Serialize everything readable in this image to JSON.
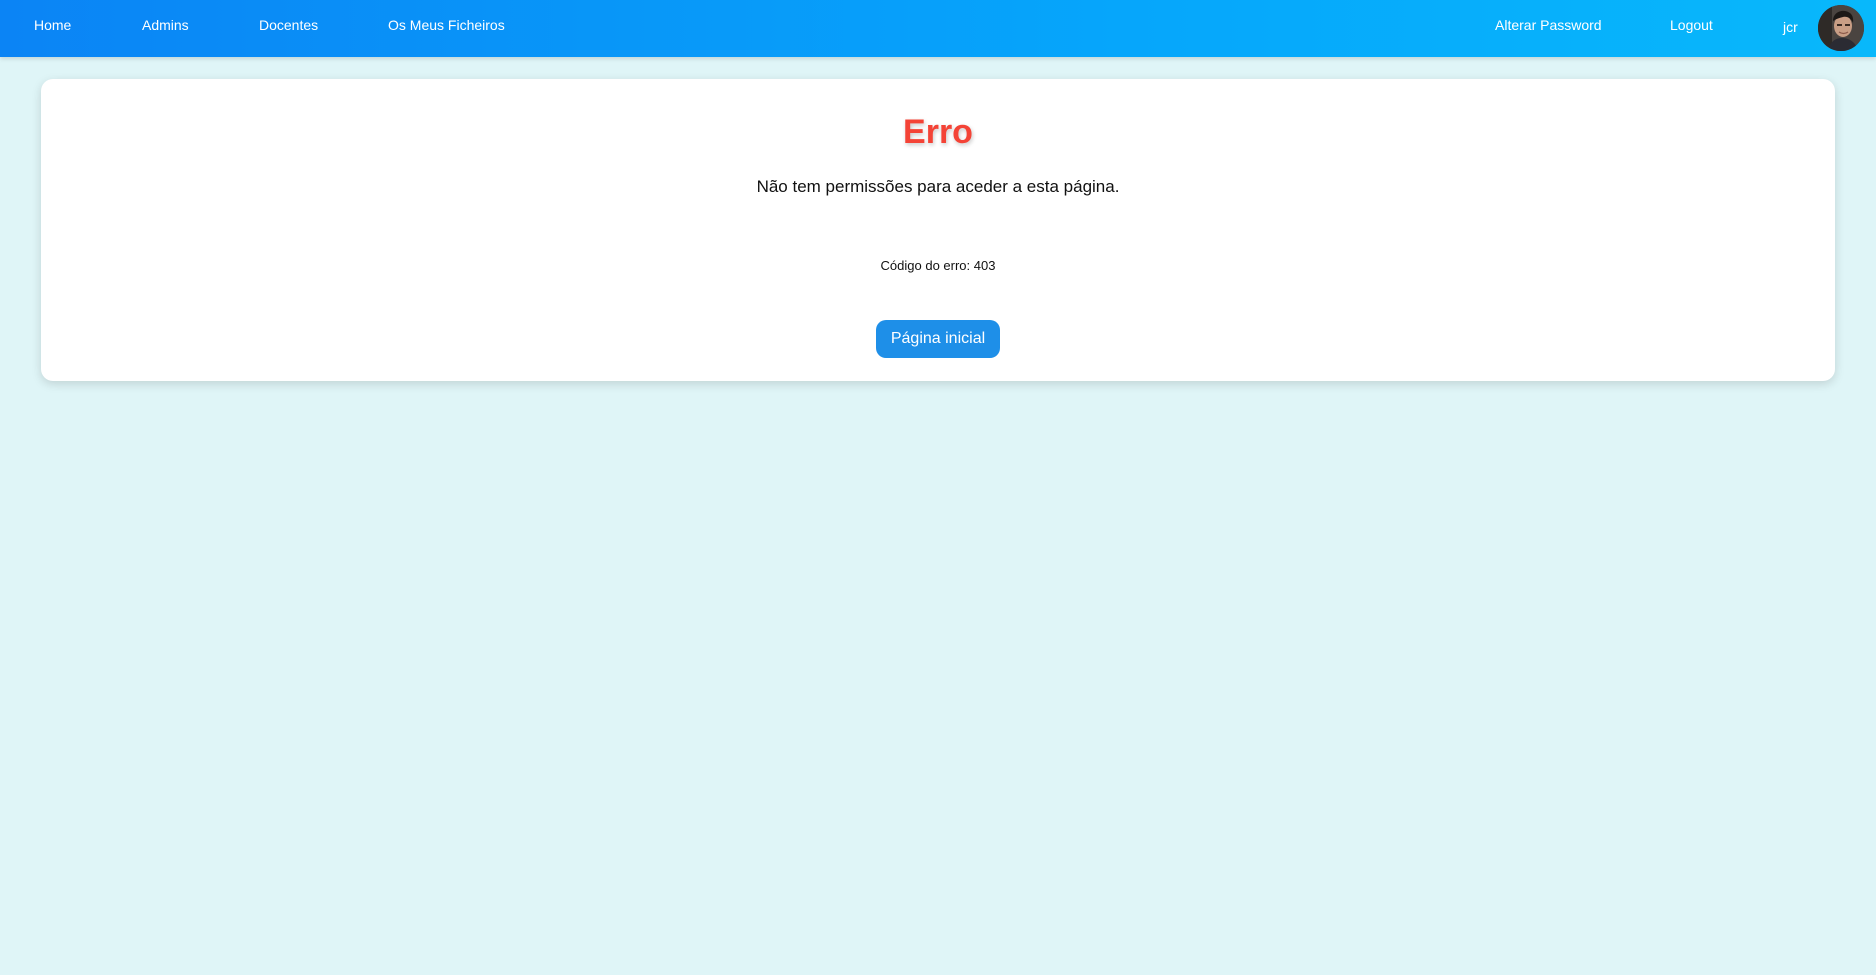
{
  "nav": {
    "left_links": [
      "Home",
      "Admins",
      "Docentes",
      "Os Meus Ficheiros"
    ],
    "change_password": "Alterar Password",
    "logout": "Logout",
    "username": "jcr"
  },
  "error": {
    "title": "Erro",
    "message": "Não tem permissões para aceder a esta página.",
    "code_text": "Código do erro: 403",
    "home_button": "Página inicial"
  },
  "colors": {
    "navbar_start": "#0b84f5",
    "navbar_end": "#08b8fb",
    "page_background": "#dff5f7",
    "error_title": "#f44336",
    "button": "#1e8fe8"
  }
}
